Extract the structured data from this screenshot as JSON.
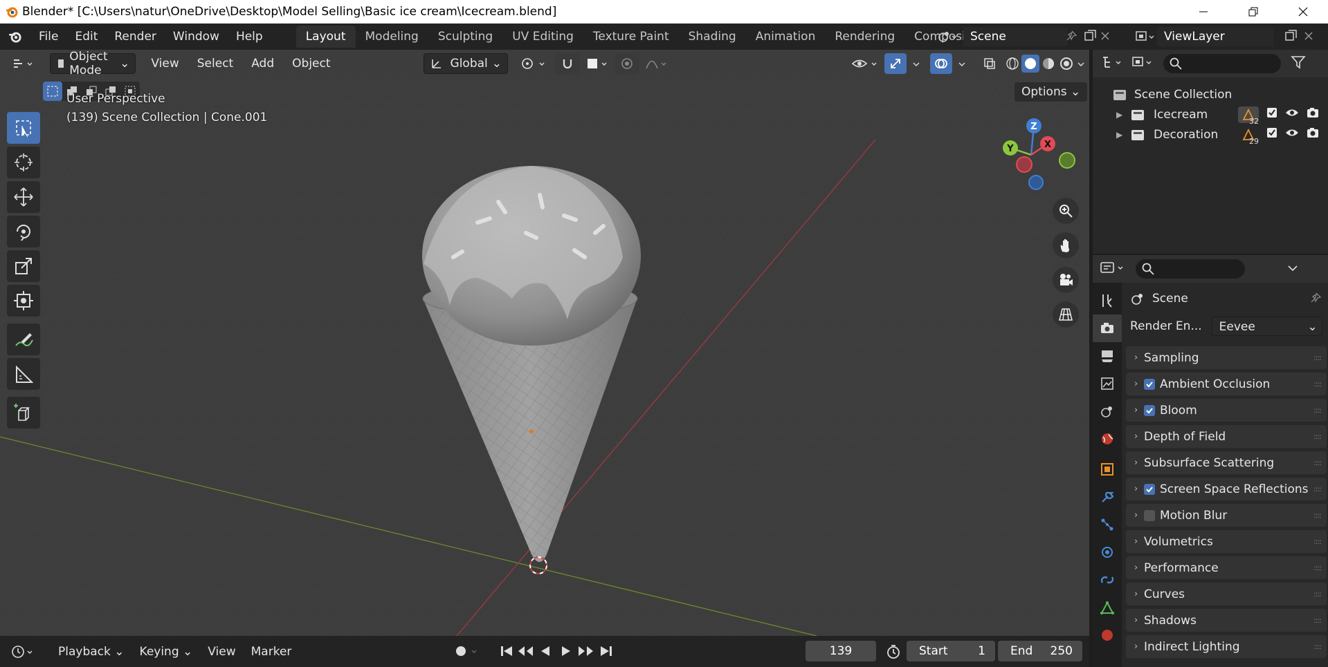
{
  "window": {
    "title": "Blender* [C:\\Users\\natur\\OneDrive\\Desktop\\Model Selling\\Basic ice cream\\Icecream.blend]"
  },
  "menu": [
    "File",
    "Edit",
    "Render",
    "Window",
    "Help"
  ],
  "workspaces": [
    "Layout",
    "Modeling",
    "Sculpting",
    "UV Editing",
    "Texture Paint",
    "Shading",
    "Animation",
    "Rendering",
    "Compositin"
  ],
  "active_workspace": "Layout",
  "scene": {
    "name": "Scene",
    "view_layer": "ViewLayer"
  },
  "viewport": {
    "mode": "Object Mode",
    "menus": [
      "View",
      "Select",
      "Add",
      "Object"
    ],
    "transform_orientation": "Global",
    "options_label": "Options",
    "info_line1": "User Perspective",
    "info_line2": "(139) Scene Collection | Cone.001",
    "gizmo_axes": {
      "x": "X",
      "y": "Y",
      "z": "Z"
    },
    "colors": {
      "x_axis": "#e34a56",
      "y_axis": "#8cc63e",
      "z_axis": "#3f7fd6",
      "accent": "#4772b3"
    }
  },
  "timeline": {
    "menus": [
      "Playback",
      "Keying",
      "View",
      "Marker"
    ],
    "current_frame": "139",
    "start_label": "Start",
    "start": "1",
    "end_label": "End",
    "end": "250"
  },
  "outliner": {
    "root": "Scene Collection",
    "collections": [
      {
        "name": "Icecream",
        "count": "32"
      },
      {
        "name": "Decoration",
        "count": "29"
      }
    ]
  },
  "properties": {
    "context": "Scene",
    "render_engine_label": "Render En...",
    "render_engine": "Eevee",
    "panels": [
      {
        "label": "Sampling",
        "checkbox": "none"
      },
      {
        "label": "Ambient Occlusion",
        "checkbox": "on"
      },
      {
        "label": "Bloom",
        "checkbox": "on"
      },
      {
        "label": "Depth of Field",
        "checkbox": "none"
      },
      {
        "label": "Subsurface Scattering",
        "checkbox": "none"
      },
      {
        "label": "Screen Space Reflections",
        "checkbox": "on"
      },
      {
        "label": "Motion Blur",
        "checkbox": "off"
      },
      {
        "label": "Volumetrics",
        "checkbox": "none"
      },
      {
        "label": "Performance",
        "checkbox": "none"
      },
      {
        "label": "Curves",
        "checkbox": "none"
      },
      {
        "label": "Shadows",
        "checkbox": "none"
      },
      {
        "label": "Indirect Lighting",
        "checkbox": "none"
      }
    ]
  }
}
